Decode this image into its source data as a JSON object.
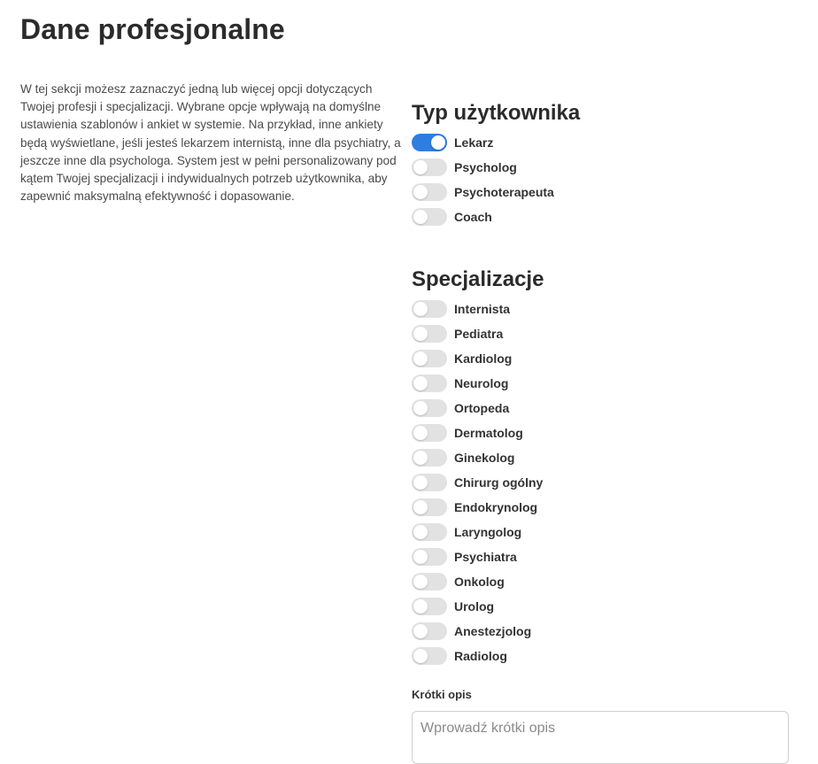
{
  "page": {
    "title": "Dane profesjonalne",
    "description": "W tej sekcji możesz zaznaczyć jedną lub więcej opcji dotyczących Twojej profesji i specjalizacji. Wybrane opcje wpływają na domyślne ustawienia szablonów i ankiet w systemie. Na przykład, inne ankiety będą wyświetlane, jeśli jesteś lekarzem internistą, inne dla psychiatry, a jeszcze inne dla psychologa. System jest w pełni personalizowany pod kątem Twojej specjalizacji i indywidualnych potrzeb użytkownika, aby zapewnić maksymalną efektywność i dopasowanie."
  },
  "user_type": {
    "title": "Typ użytkownika",
    "items": [
      {
        "label": "Lekarz",
        "checked": true
      },
      {
        "label": "Psycholog",
        "checked": false
      },
      {
        "label": "Psychoterapeuta",
        "checked": false
      },
      {
        "label": "Coach",
        "checked": false
      }
    ]
  },
  "specializations": {
    "title": "Specjalizacje",
    "items": [
      {
        "label": "Internista",
        "checked": false
      },
      {
        "label": "Pediatra",
        "checked": false
      },
      {
        "label": "Kardiolog",
        "checked": false
      },
      {
        "label": "Neurolog",
        "checked": false
      },
      {
        "label": "Ortopeda",
        "checked": false
      },
      {
        "label": "Dermatolog",
        "checked": false
      },
      {
        "label": "Ginekolog",
        "checked": false
      },
      {
        "label": "Chirurg ogólny",
        "checked": false
      },
      {
        "label": "Endokrynolog",
        "checked": false
      },
      {
        "label": "Laryngolog",
        "checked": false
      },
      {
        "label": "Psychiatra",
        "checked": false
      },
      {
        "label": "Onkolog",
        "checked": false
      },
      {
        "label": "Urolog",
        "checked": false
      },
      {
        "label": "Anestezjolog",
        "checked": false
      },
      {
        "label": "Radiolog",
        "checked": false
      }
    ]
  },
  "short_description": {
    "label": "Krótki opis",
    "value": "",
    "placeholder": "Wprowadź krótki opis"
  },
  "colors": {
    "toggle_on": "#2f7de1",
    "toggle_off": "#e2e2e2",
    "text_primary": "#2b2b2b"
  }
}
